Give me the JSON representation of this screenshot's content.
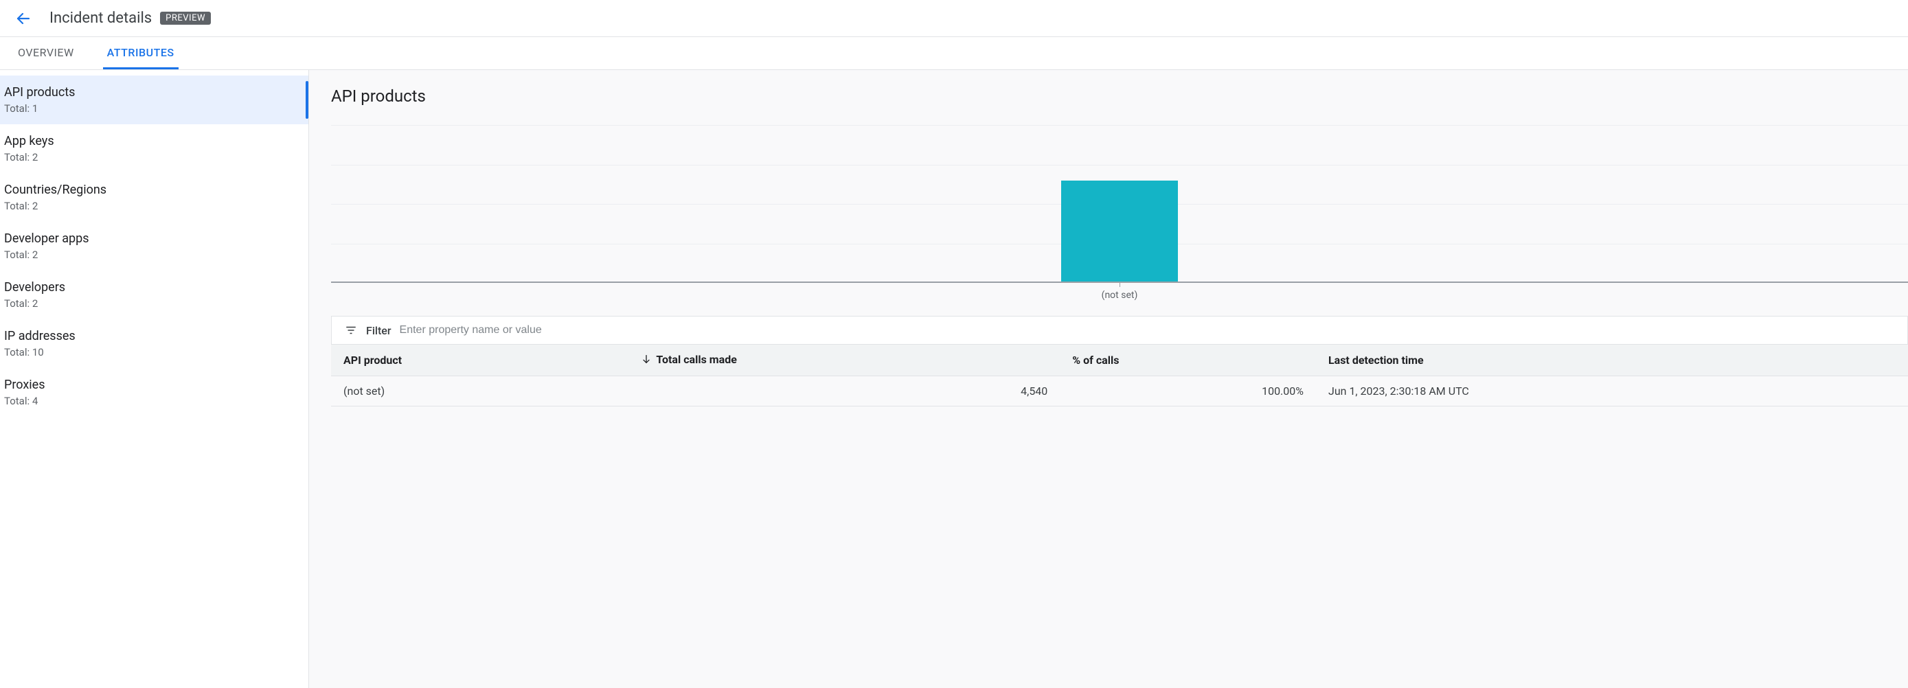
{
  "header": {
    "title": "Incident details",
    "badge": "PREVIEW"
  },
  "tabs": [
    {
      "id": "overview",
      "label": "OVERVIEW",
      "active": false
    },
    {
      "id": "attributes",
      "label": "ATTRIBUTES",
      "active": true
    }
  ],
  "sidebar": {
    "total_prefix": "Total: ",
    "items": [
      {
        "id": "api-products",
        "label": "API products",
        "total": 1,
        "selected": true
      },
      {
        "id": "app-keys",
        "label": "App keys",
        "total": 2,
        "selected": false
      },
      {
        "id": "countries-regions",
        "label": "Countries/Regions",
        "total": 2,
        "selected": false
      },
      {
        "id": "developer-apps",
        "label": "Developer apps",
        "total": 2,
        "selected": false
      },
      {
        "id": "developers",
        "label": "Developers",
        "total": 2,
        "selected": false
      },
      {
        "id": "ip-addresses",
        "label": "IP addresses",
        "total": 10,
        "selected": false
      },
      {
        "id": "proxies",
        "label": "Proxies",
        "total": 4,
        "selected": false
      }
    ]
  },
  "main": {
    "section_title": "API products"
  },
  "filter": {
    "label": "Filter",
    "placeholder": "Enter property name or value"
  },
  "table": {
    "columns": {
      "product": "API product",
      "calls": "Total calls made",
      "pct": "% of calls",
      "last": "Last detection time"
    },
    "sort_column": "calls",
    "sort_dir": "desc",
    "rows": [
      {
        "product": "(not set)",
        "calls": "4,540",
        "pct": "100.00%",
        "last": "Jun 1, 2023, 2:30:18 AM UTC"
      }
    ]
  },
  "chart_data": {
    "type": "bar",
    "categories": [
      "(not set)"
    ],
    "values": [
      4540
    ],
    "title": "",
    "xlabel": "",
    "ylabel": "",
    "ylim": [
      0,
      7000
    ],
    "bar_color": "#14b4c6",
    "gridlines": 4
  }
}
